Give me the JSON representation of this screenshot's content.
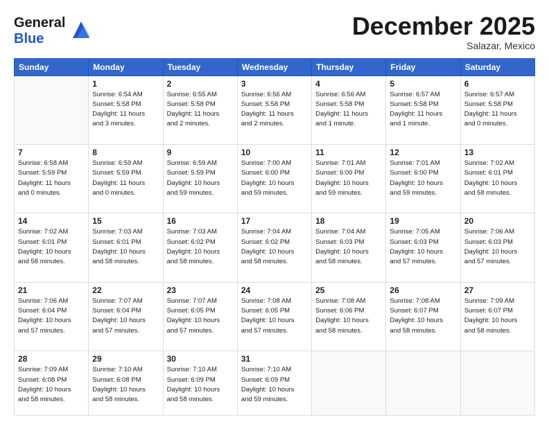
{
  "logo": {
    "line1": "General",
    "line2": "Blue"
  },
  "title": "December 2025",
  "location": "Salazar, Mexico",
  "days_header": [
    "Sunday",
    "Monday",
    "Tuesday",
    "Wednesday",
    "Thursday",
    "Friday",
    "Saturday"
  ],
  "weeks": [
    [
      {
        "day": "",
        "info": ""
      },
      {
        "day": "1",
        "info": "Sunrise: 6:54 AM\nSunset: 5:58 PM\nDaylight: 11 hours\nand 3 minutes."
      },
      {
        "day": "2",
        "info": "Sunrise: 6:55 AM\nSunset: 5:58 PM\nDaylight: 11 hours\nand 2 minutes."
      },
      {
        "day": "3",
        "info": "Sunrise: 6:56 AM\nSunset: 5:58 PM\nDaylight: 11 hours\nand 2 minutes."
      },
      {
        "day": "4",
        "info": "Sunrise: 6:56 AM\nSunset: 5:58 PM\nDaylight: 11 hours\nand 1 minute."
      },
      {
        "day": "5",
        "info": "Sunrise: 6:57 AM\nSunset: 5:58 PM\nDaylight: 11 hours\nand 1 minute."
      },
      {
        "day": "6",
        "info": "Sunrise: 6:57 AM\nSunset: 5:58 PM\nDaylight: 11 hours\nand 0 minutes."
      }
    ],
    [
      {
        "day": "7",
        "info": "Sunrise: 6:58 AM\nSunset: 5:59 PM\nDaylight: 11 hours\nand 0 minutes."
      },
      {
        "day": "8",
        "info": "Sunrise: 6:59 AM\nSunset: 5:59 PM\nDaylight: 11 hours\nand 0 minutes."
      },
      {
        "day": "9",
        "info": "Sunrise: 6:59 AM\nSunset: 5:59 PM\nDaylight: 10 hours\nand 59 minutes."
      },
      {
        "day": "10",
        "info": "Sunrise: 7:00 AM\nSunset: 6:00 PM\nDaylight: 10 hours\nand 59 minutes."
      },
      {
        "day": "11",
        "info": "Sunrise: 7:01 AM\nSunset: 6:00 PM\nDaylight: 10 hours\nand 59 minutes."
      },
      {
        "day": "12",
        "info": "Sunrise: 7:01 AM\nSunset: 6:00 PM\nDaylight: 10 hours\nand 59 minutes."
      },
      {
        "day": "13",
        "info": "Sunrise: 7:02 AM\nSunset: 6:01 PM\nDaylight: 10 hours\nand 58 minutes."
      }
    ],
    [
      {
        "day": "14",
        "info": "Sunrise: 7:02 AM\nSunset: 6:01 PM\nDaylight: 10 hours\nand 58 minutes."
      },
      {
        "day": "15",
        "info": "Sunrise: 7:03 AM\nSunset: 6:01 PM\nDaylight: 10 hours\nand 58 minutes."
      },
      {
        "day": "16",
        "info": "Sunrise: 7:03 AM\nSunset: 6:02 PM\nDaylight: 10 hours\nand 58 minutes."
      },
      {
        "day": "17",
        "info": "Sunrise: 7:04 AM\nSunset: 6:02 PM\nDaylight: 10 hours\nand 58 minutes."
      },
      {
        "day": "18",
        "info": "Sunrise: 7:04 AM\nSunset: 6:03 PM\nDaylight: 10 hours\nand 58 minutes."
      },
      {
        "day": "19",
        "info": "Sunrise: 7:05 AM\nSunset: 6:03 PM\nDaylight: 10 hours\nand 57 minutes."
      },
      {
        "day": "20",
        "info": "Sunrise: 7:06 AM\nSunset: 6:03 PM\nDaylight: 10 hours\nand 57 minutes."
      }
    ],
    [
      {
        "day": "21",
        "info": "Sunrise: 7:06 AM\nSunset: 6:04 PM\nDaylight: 10 hours\nand 57 minutes."
      },
      {
        "day": "22",
        "info": "Sunrise: 7:07 AM\nSunset: 6:04 PM\nDaylight: 10 hours\nand 57 minutes."
      },
      {
        "day": "23",
        "info": "Sunrise: 7:07 AM\nSunset: 6:05 PM\nDaylight: 10 hours\nand 57 minutes."
      },
      {
        "day": "24",
        "info": "Sunrise: 7:08 AM\nSunset: 6:05 PM\nDaylight: 10 hours\nand 57 minutes."
      },
      {
        "day": "25",
        "info": "Sunrise: 7:08 AM\nSunset: 6:06 PM\nDaylight: 10 hours\nand 58 minutes."
      },
      {
        "day": "26",
        "info": "Sunrise: 7:08 AM\nSunset: 6:07 PM\nDaylight: 10 hours\nand 58 minutes."
      },
      {
        "day": "27",
        "info": "Sunrise: 7:09 AM\nSunset: 6:07 PM\nDaylight: 10 hours\nand 58 minutes."
      }
    ],
    [
      {
        "day": "28",
        "info": "Sunrise: 7:09 AM\nSunset: 6:08 PM\nDaylight: 10 hours\nand 58 minutes."
      },
      {
        "day": "29",
        "info": "Sunrise: 7:10 AM\nSunset: 6:08 PM\nDaylight: 10 hours\nand 58 minutes."
      },
      {
        "day": "30",
        "info": "Sunrise: 7:10 AM\nSunset: 6:09 PM\nDaylight: 10 hours\nand 58 minutes."
      },
      {
        "day": "31",
        "info": "Sunrise: 7:10 AM\nSunset: 6:09 PM\nDaylight: 10 hours\nand 59 minutes."
      },
      {
        "day": "",
        "info": ""
      },
      {
        "day": "",
        "info": ""
      },
      {
        "day": "",
        "info": ""
      }
    ]
  ]
}
